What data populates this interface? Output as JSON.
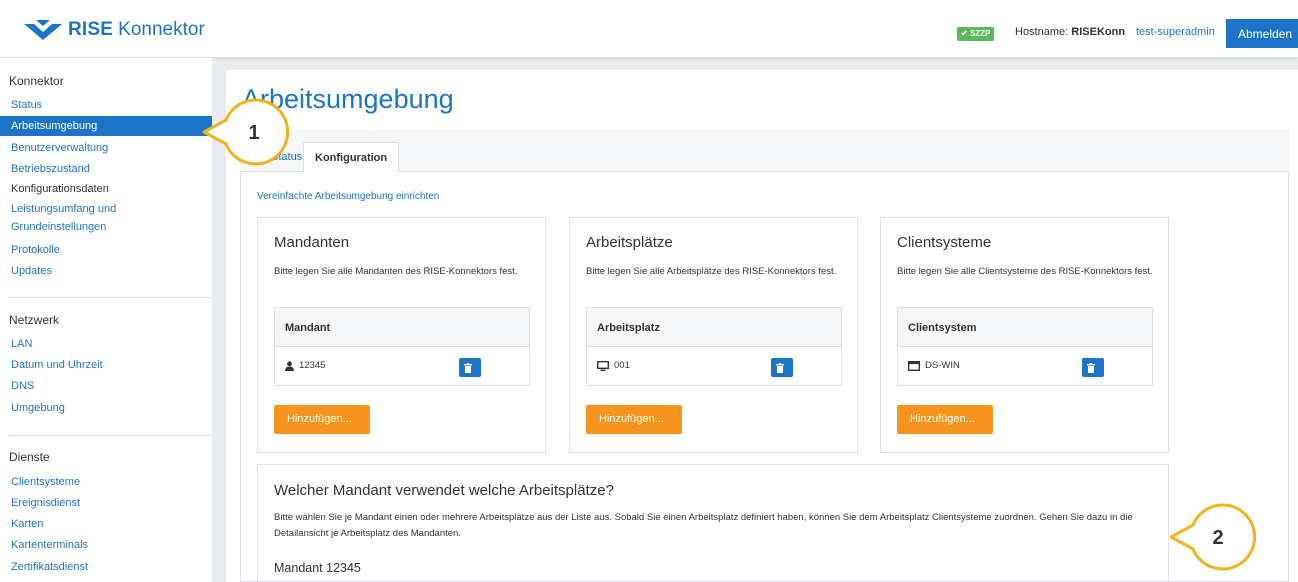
{
  "header": {
    "logo_brand": "RISE",
    "logo_product": "Konnektor",
    "badge": "✔ SZZP",
    "hostname_label": "Hostname:",
    "hostname_value": "RISEKonn",
    "user": "test-superadmin",
    "logout_label": "Abmelden"
  },
  "sidebar": {
    "konnektor": {
      "heading": "Konnektor",
      "items": [
        "Status",
        "Arbeitsumgebung",
        "Benutzerverwaltung",
        "Betriebszustand",
        "Konfigurationsdaten",
        "Leistungsumfang und",
        "Grundeinstellungen",
        "Protokolle",
        "Updates"
      ]
    },
    "netzwerk": {
      "heading": "Netzwerk",
      "items": [
        "LAN",
        "Datum und Uhrzeit",
        "DNS",
        "Umgebung"
      ]
    },
    "dienste": {
      "heading": "Dienste",
      "items": [
        "Clientsysteme",
        "Ereignisdienst",
        "Karten",
        "Kartenterminals",
        "Zertifikatsdienst"
      ]
    }
  },
  "page": {
    "title": "Arbeitsumgebung",
    "tabs": [
      "Status",
      "Konfiguration"
    ],
    "simple_link": "Vereinfachte Arbeitsumgebung einrichten"
  },
  "cards": [
    {
      "title": "Mandanten",
      "description": "Bitte legen Sie alle Mandanten des RISE-Konnektors fest.",
      "column": "Mandant",
      "row": "12345",
      "icon": "user-icon",
      "add_label": "Hinzufügen..."
    },
    {
      "title": "Arbeitsplätze",
      "description": "Bitte legen Sie alle Arbeitsplätze des RISE-Konnektors fest.",
      "column": "Arbeitsplatz",
      "row": "001",
      "icon": "desktop-icon",
      "add_label": "Hinzufügen..."
    },
    {
      "title": "Clientsysteme",
      "description": "Bitte legen Sie alle Clientsysteme des RISE-Konnektors fest.",
      "column": "Clientsystem",
      "row": "DS-WIN",
      "icon": "window-icon",
      "add_label": "Hinzufügen..."
    }
  ],
  "mapping": {
    "title": "Welcher Mandant verwendet welche Arbeitsplätze?",
    "description": "Bitte wählen Sie je Mandant einen oder mehrere Arbeitsplätze aus der Liste aus. Sobald Sie einen Arbeitsplatz definiert haben, können Sie dem Arbeitsplatz Clientsysteme zuordnen. Gehen Sie dazu in die Detailansicht je Arbeitsplatz des Mandanten.",
    "subheading": "Mandant 12345"
  },
  "callouts": [
    "1",
    "2"
  ],
  "colors": {
    "primary": "#1b74c8",
    "accent": "#f7941d",
    "badge": "#5cb85c",
    "callout_ring": "#f2b21b"
  }
}
